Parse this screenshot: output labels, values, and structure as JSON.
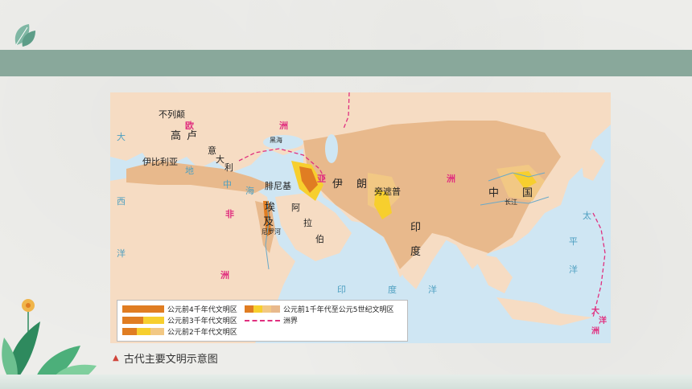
{
  "map": {
    "labels": {
      "buliedian": "不列颠",
      "ou": "欧",
      "gao": "高",
      "lu": "卢",
      "yi": "意",
      "da": "大",
      "li": "利",
      "yibiliya": "伊比利亚",
      "zhou_eu": "洲",
      "di": "地",
      "zhong_sea": "中",
      "hai_sea": "海",
      "feinike": "腓尼基",
      "yi_ran": "伊",
      "lang": "朗",
      "zhepu": "旁遮普",
      "aji": "埃",
      "ji": "及",
      "a": "阿",
      "la": "拉",
      "bo": "伯",
      "fei": "非",
      "zhou_af": "洲",
      "xi": "西",
      "yang_w": "洋",
      "da_w": "大",
      "yin": "印",
      "du": "度",
      "yin_sea": "印",
      "du_sea": "度",
      "yang_sea": "洋",
      "zhongguo_zhong": "中",
      "zhongguo_guo": "国",
      "zhou_as": "洲",
      "ya": "亚",
      "tai": "太",
      "ping": "平",
      "yang_p": "洋",
      "heihai": "黑海",
      "changjiang": "长江",
      "oceania_da": "大",
      "oceania_yang": "洋",
      "oceania_zhou": "洲",
      "nile": "尼罗河"
    },
    "legend": {
      "millennium4": "公元前4千年代文明区",
      "millennium3": "公元前3千年代文明区",
      "millennium2": "公元前2千年代文明区",
      "millennium1": "公元前1千年代至公元5世纪文明区",
      "boundary": "洲界"
    },
    "caption": "古代主要文明示意图",
    "colors": {
      "sea": "#cfe6f3",
      "land": "#f6dcc3",
      "civ_late": "#e8b98c",
      "civ_2k": "#f2c884",
      "civ_3k": "#f7cf2e",
      "civ_4k": "#e07d22",
      "boundary": "#e0307f"
    }
  }
}
